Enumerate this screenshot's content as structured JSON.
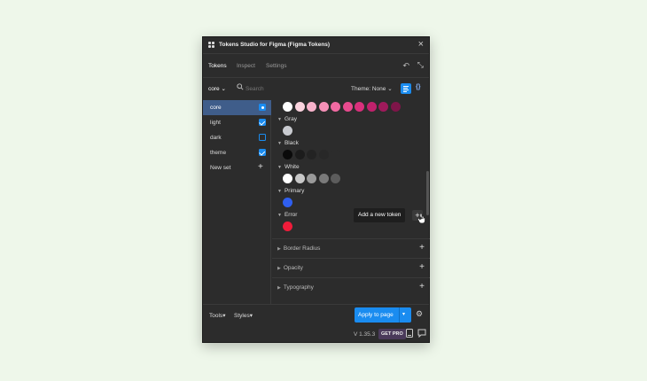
{
  "window": {
    "title": "Tokens Studio for Figma (Figma Tokens)"
  },
  "tabs": [
    {
      "label": "Tokens"
    },
    {
      "label": "Inspect"
    },
    {
      "label": "Settings"
    }
  ],
  "toolbar": {
    "set_select": "core",
    "search_placeholder": "Search",
    "theme_select": "Theme: None"
  },
  "sidebar": {
    "items": [
      {
        "label": "core"
      },
      {
        "label": "light"
      },
      {
        "label": "dark"
      },
      {
        "label": "theme"
      }
    ],
    "new_set_label": "New set"
  },
  "content": {
    "groups": [
      {
        "label": "Gray",
        "colors": [
          "#c9cbd0"
        ]
      },
      {
        "label": "Black",
        "colors": [
          "#0a0a0a",
          "#1c1c1c",
          "#232323",
          "#282828",
          "#2c2c2c"
        ]
      },
      {
        "label": "White",
        "colors": [
          "#ffffff",
          "#c8c8c8",
          "#9a9a9a",
          "#7a7a7a",
          "#5c5c5c"
        ]
      },
      {
        "label": "Primary",
        "colors": [
          "#2f5ff0"
        ]
      },
      {
        "label": "Error",
        "colors": [
          "#ef1c3a"
        ]
      }
    ],
    "top_row_colors": [
      "#ffffff",
      "#fbd3de",
      "#f8b3cb",
      "#f590b7",
      "#f16aa2",
      "#e84a8e",
      "#d9307c",
      "#c0216c",
      "#9f1a5b",
      "#7e1549"
    ],
    "tooltip": "Add a new token",
    "sections": [
      {
        "label": "Border Radius"
      },
      {
        "label": "Opacity"
      },
      {
        "label": "Typography"
      }
    ]
  },
  "footer": {
    "tools": "Tools",
    "styles": "Styles",
    "apply": "Apply to page"
  },
  "bottombar": {
    "version": "V 1.35.3",
    "get_pro": "GET PRO"
  }
}
